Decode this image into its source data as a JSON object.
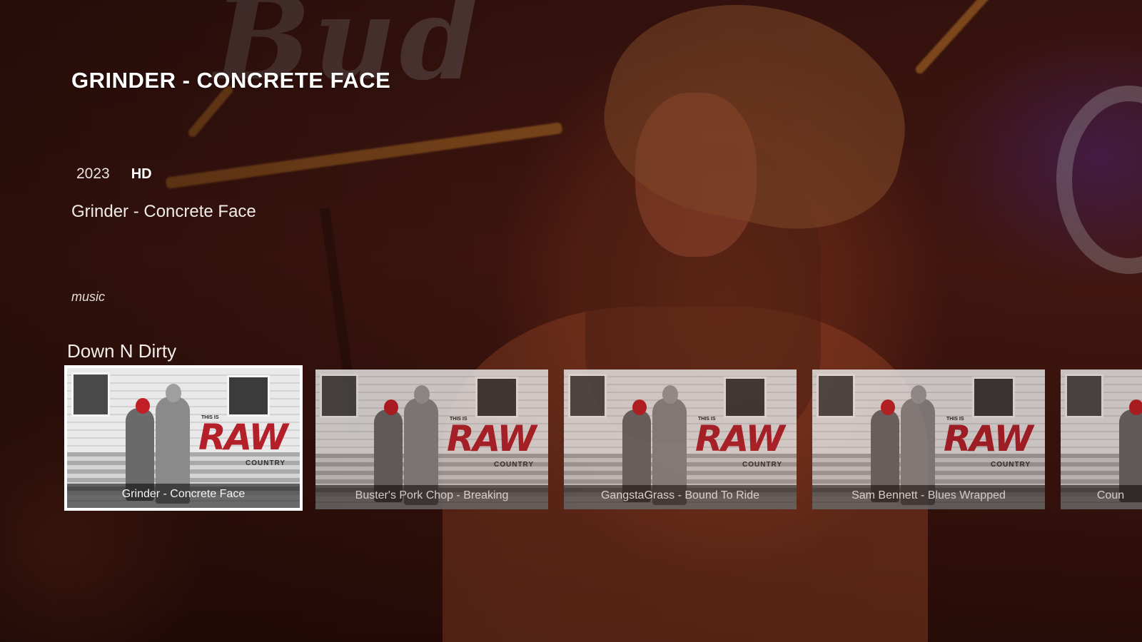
{
  "details": {
    "title": "GRINDER - CONCRETE FACE",
    "year": "2023",
    "quality": "HD",
    "subtitle": "Grinder - Concrete Face",
    "genre": "music"
  },
  "row": {
    "title": "Down N Dirty",
    "cards": [
      {
        "caption": "Grinder - Concrete Face",
        "focused": true
      },
      {
        "caption": "Buster's Pork Chop - Breaking",
        "focused": false
      },
      {
        "caption": "GangstaGrass - Bound To Ride",
        "focused": false
      },
      {
        "caption": "Sam Bennett - Blues Wrapped",
        "focused": false
      },
      {
        "caption": "Coun",
        "focused": false
      }
    ],
    "card_art": {
      "small_text": "THIS IS",
      "brand": "RAW",
      "brand_sub": "COUNTRY"
    }
  },
  "colors": {
    "accent": "#ffffff",
    "brand_red": "#b3202a"
  }
}
